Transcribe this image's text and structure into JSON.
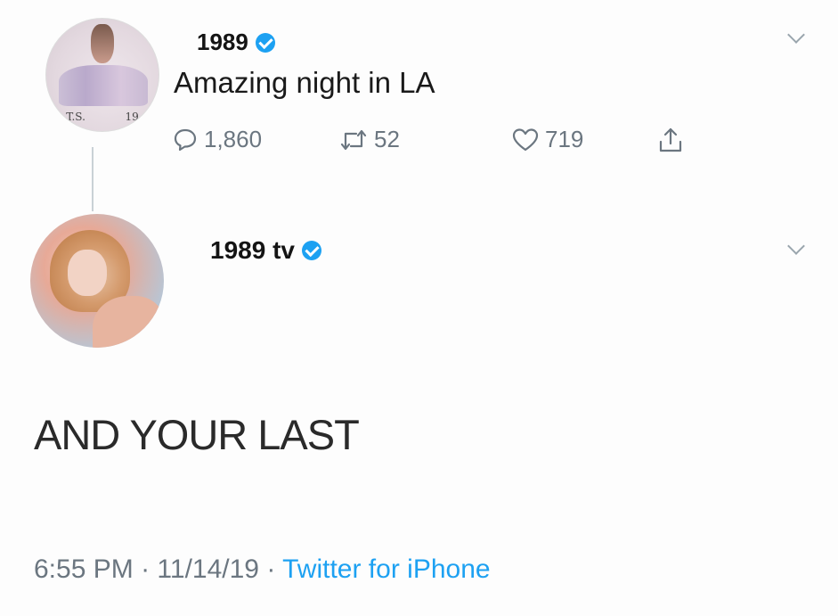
{
  "tweet1": {
    "author": "1989",
    "text": "Amazing night in LA",
    "avatar_text": [
      "T.S.",
      "19"
    ],
    "stats": {
      "replies": "1,860",
      "retweets": "52",
      "likes": "719"
    }
  },
  "tweet2": {
    "author": "1989 tv",
    "text": "AND YOUR LAST",
    "time": "6:55 PM",
    "date": "11/14/19",
    "source": "Twitter for iPhone",
    "separator": "·"
  },
  "icons": {
    "verified": "verified-badge-icon",
    "caret": "chevron-down-icon",
    "reply": "reply-icon",
    "retweet": "retweet-icon",
    "like": "heart-icon",
    "share": "share-icon"
  },
  "colors": {
    "accent": "#1da1f2",
    "muted": "#6b7680"
  }
}
